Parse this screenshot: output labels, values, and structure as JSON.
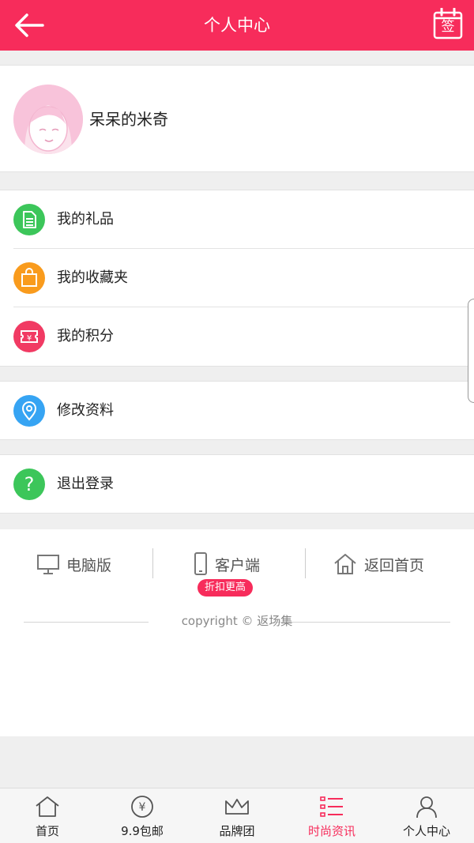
{
  "header": {
    "title": "个人中心",
    "sign_label": "签"
  },
  "profile": {
    "username": "呆呆的米奇"
  },
  "menu_group_1": [
    {
      "label": "我的礼品",
      "icon": "gift-document-icon",
      "color": "#3cc65a"
    },
    {
      "label": "我的收藏夹",
      "icon": "shopping-bag-icon",
      "color": "#f99b1d"
    },
    {
      "label": "我的积分",
      "icon": "points-ticket-icon",
      "color": "#f13a63"
    }
  ],
  "menu_group_2": [
    {
      "label": "修改资料",
      "icon": "location-pin-icon",
      "color": "#36a4f3"
    }
  ],
  "menu_group_3": [
    {
      "label": "退出登录",
      "icon": "question-icon",
      "color": "#3cc65a"
    }
  ],
  "footer": {
    "desktop_label": "电脑版",
    "client_label": "客户端",
    "client_badge": "折扣更高",
    "home_label": "返回首页",
    "copyright": "copyright © 返场集"
  },
  "tabbar": [
    {
      "label": "首页",
      "icon": "home-icon",
      "active": false
    },
    {
      "label": "9.9包邮",
      "icon": "yen-coin-icon",
      "active": false
    },
    {
      "label": "品牌团",
      "icon": "crown-icon",
      "active": false
    },
    {
      "label": "时尚资讯",
      "icon": "list-icon",
      "active": true
    },
    {
      "label": "个人中心",
      "icon": "user-icon",
      "active": false
    }
  ],
  "colors": {
    "brand": "#f72c5b",
    "active_tab": "#f72c5b"
  }
}
